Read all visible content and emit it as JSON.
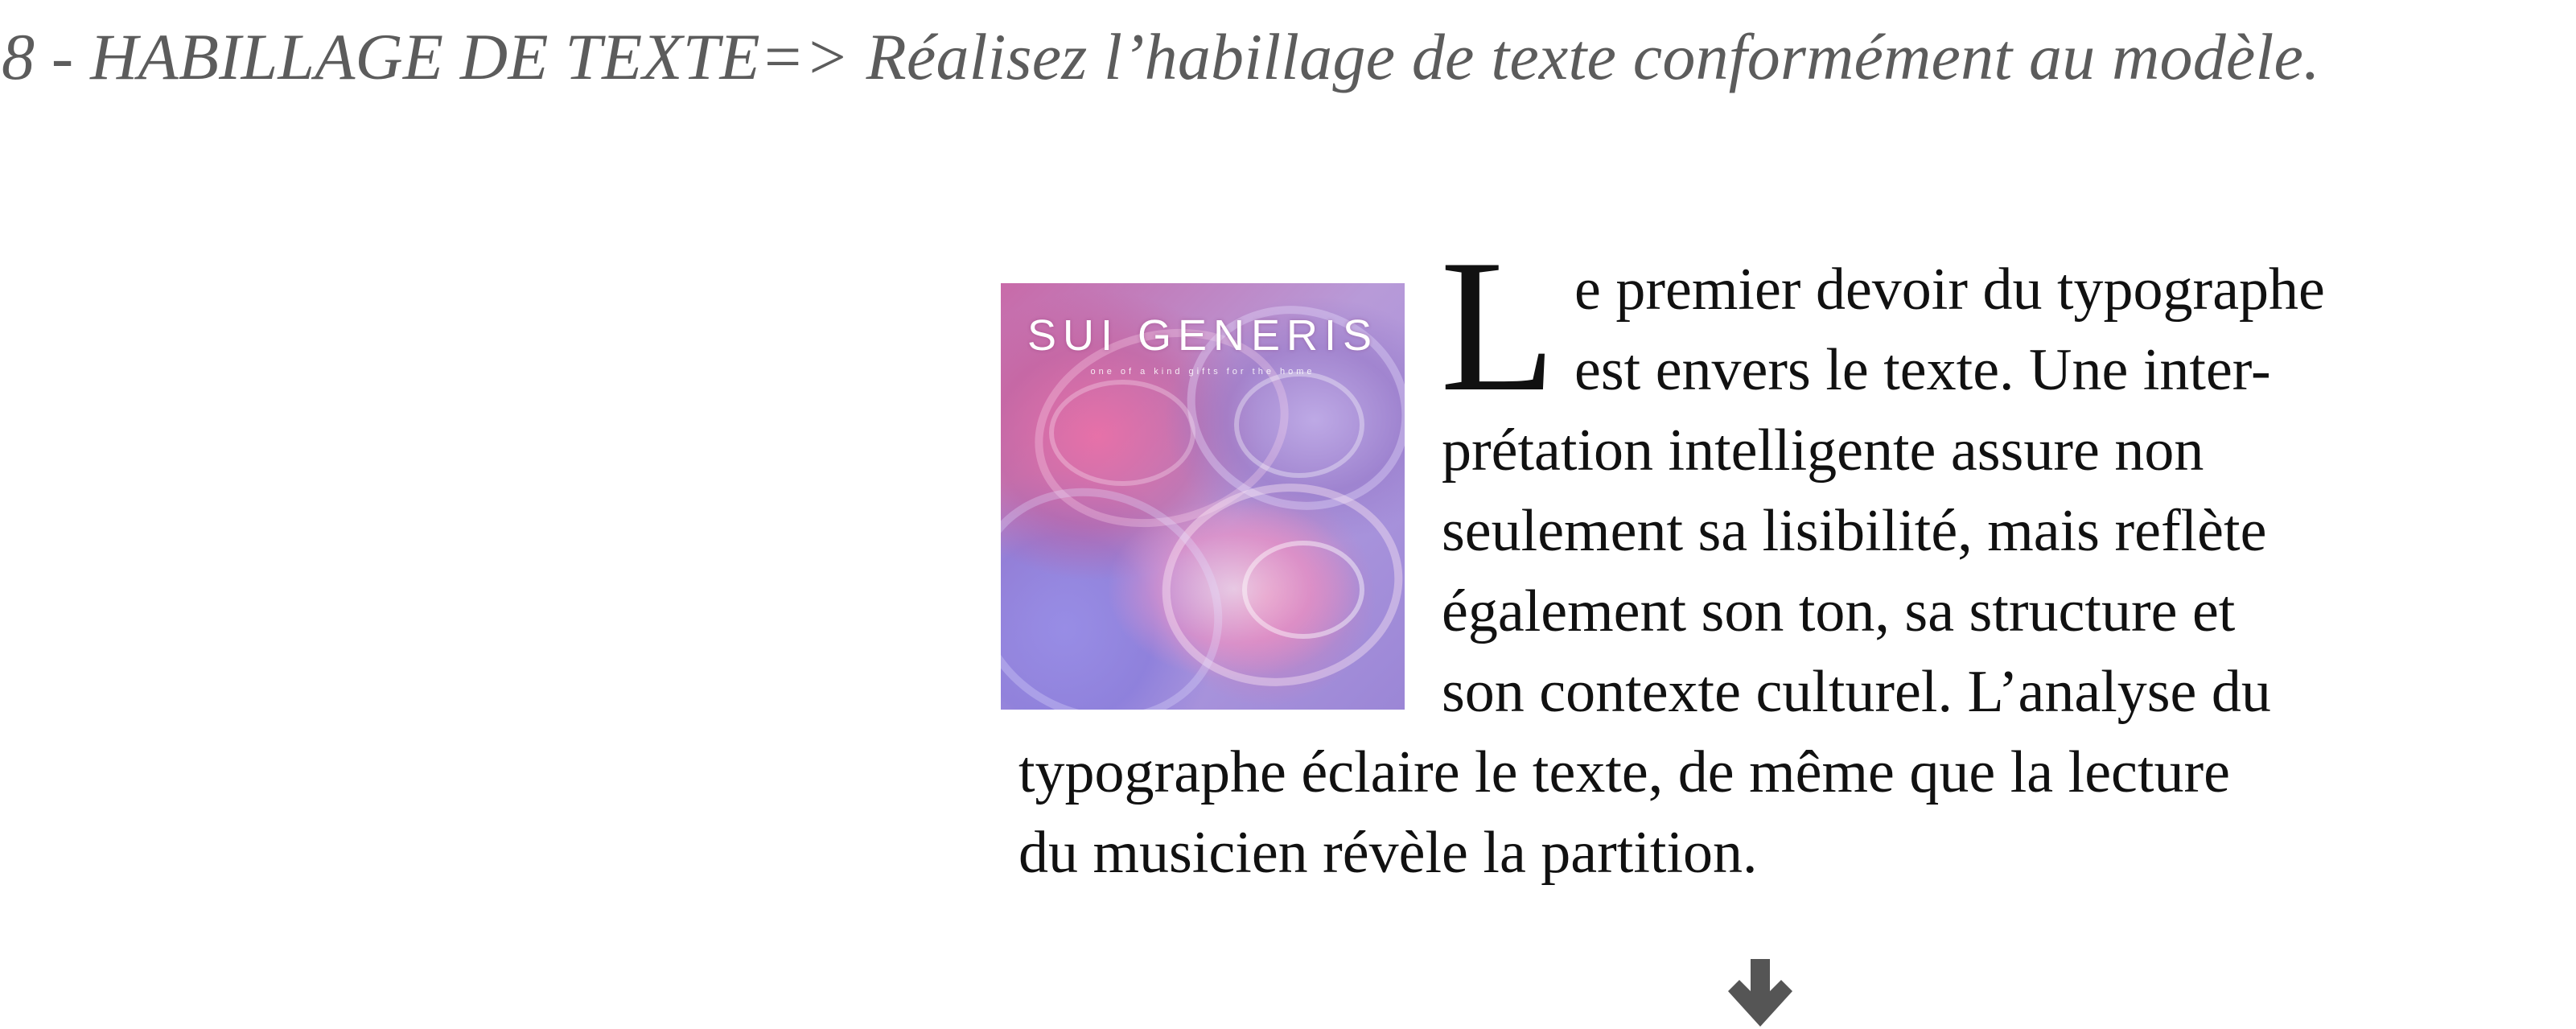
{
  "instruction": {
    "text": "8 - HABILLAGE DE TEXTE=> Réalisez l’habillage de texte conformément au modèle."
  },
  "cover_image": {
    "title": "SUI GENERIS",
    "tagline": "one of a kind gifts for the home"
  },
  "paragraph": {
    "dropcap": "L",
    "lines": [
      "e premier devoir du typographe",
      "est envers le texte. Une inter-",
      "prétation intelligente assure non",
      "seulement sa lisibilité, mais reflète",
      "également son ton, sa structure et",
      "son contexte culturel. L’analyse du",
      "typographe éclaire le texte, de même que la lecture",
      "du musicien révèle la partition."
    ]
  },
  "colors": {
    "heading": "#5c5c5c",
    "body_text": "#111111",
    "arrow": "#555555"
  },
  "icons": {
    "arrow": "arrow-down-icon"
  }
}
